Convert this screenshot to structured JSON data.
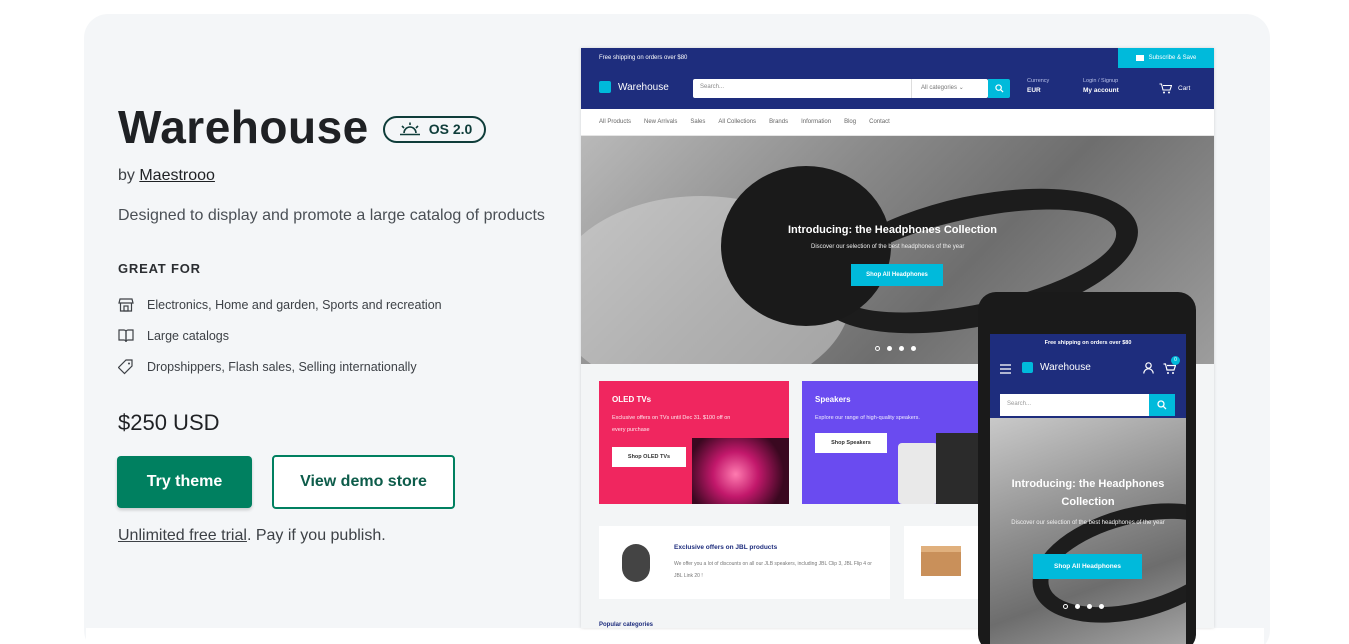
{
  "theme": {
    "title": "Warehouse",
    "badge": "OS 2.0",
    "by_prefix": "by ",
    "author": "Maestrooo",
    "description": "Designed to display and promote a large catalog of products",
    "great_for_heading": "GREAT FOR",
    "features": [
      {
        "icon": "store-icon",
        "label": "Electronics, Home and garden, Sports and recreation"
      },
      {
        "icon": "book-icon",
        "label": "Large catalogs"
      },
      {
        "icon": "tag-icon",
        "label": "Dropshippers, Flash sales, Selling internationally"
      }
    ],
    "price": "$250 USD",
    "try_label": "Try theme",
    "demo_label": "View demo store",
    "trial_link": "Unlimited free trial",
    "trial_rest": ". Pay if you publish."
  },
  "desktop_preview": {
    "topbar": "Free shipping on orders over $80",
    "subscribe": "Subscribe & Save",
    "logo": "Warehouse",
    "search_placeholder": "Search...",
    "category": "All categories",
    "currency_label": "Currency",
    "currency_value": "EUR",
    "account_label": "Login / Signup",
    "account_value": "My account",
    "cart": "Cart",
    "nav": [
      "All Products",
      "New Arrivals",
      "Sales",
      "All Collections",
      "Brands",
      "Information",
      "Blog",
      "Contact"
    ],
    "hero_title": "Introducing: the Headphones Collection",
    "hero_sub": "Discover our selection of the best headphones of the year",
    "hero_cta": "Shop All Headphones",
    "tile1_title": "OLED TVs",
    "tile1_text": "Exclusive offers on TVs until Dec 31. $100 off on every purchase",
    "tile1_btn": "Shop OLED TVs",
    "tile2_title": "Speakers",
    "tile2_text": "Explore our range of high-quality speakers.",
    "tile2_btn": "Shop Speakers",
    "jbl_title": "Exclusive offers on JBL products",
    "jbl_text": "We offer you a lot of discounts on all our JLB speakers, including JBL Clip 3, JBL Flip 4 or JBL Link 20 !",
    "popular": "Popular categories",
    "colors": {
      "navy": "#1e2d7d",
      "cyan": "#00badb",
      "pink": "#f0265f",
      "purple": "#6a4bf0",
      "green": "#008060"
    }
  },
  "mobile_preview": {
    "topbar": "Free shipping on orders over $80",
    "logo": "Warehouse",
    "cart_count": "0",
    "search_placeholder": "Search...",
    "hero_title": "Introducing: the Headphones Collection",
    "hero_sub": "Discover our selection of the best headphones of the year",
    "hero_cta": "Shop All Headphones"
  }
}
